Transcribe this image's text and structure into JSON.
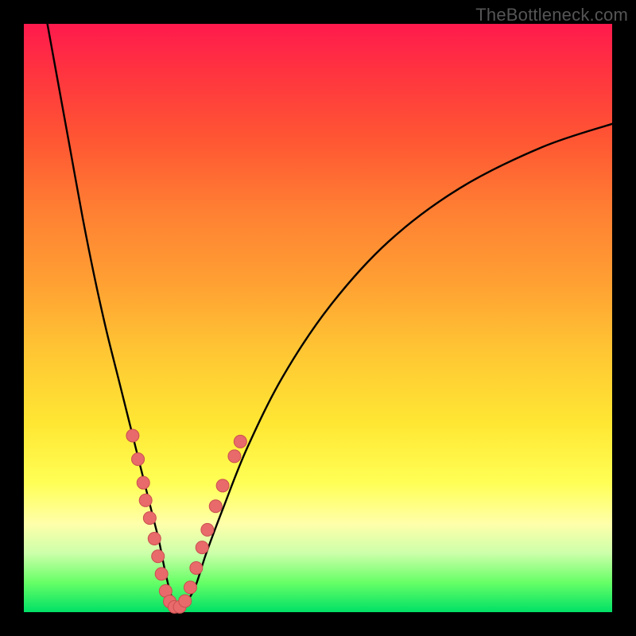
{
  "watermark": "TheBottleneck.com",
  "colors": {
    "frame": "#000000",
    "curve": "#000000",
    "dot_fill": "#e96a6a",
    "dot_stroke": "#c94f4f"
  },
  "chart_data": {
    "type": "line",
    "title": "",
    "xlabel": "",
    "ylabel": "",
    "xlim": [
      0,
      100
    ],
    "ylim": [
      0,
      100
    ],
    "series": [
      {
        "name": "bottleneck-curve",
        "x": [
          4,
          6,
          8,
          10,
          12,
          14,
          16,
          18,
          20,
          21,
          22,
          23,
          24,
          25,
          26,
          27,
          29,
          31,
          34,
          38,
          44,
          52,
          62,
          74,
          88,
          100
        ],
        "y": [
          100,
          89,
          78,
          67,
          57,
          48,
          40,
          32,
          24,
          20,
          16,
          12,
          7,
          3,
          1,
          1,
          4,
          10,
          18,
          28,
          40,
          52,
          63,
          72,
          79,
          83
        ]
      }
    ],
    "dots": {
      "name": "highlight-dots",
      "points": [
        {
          "x": 18.5,
          "y": 30
        },
        {
          "x": 19.4,
          "y": 26
        },
        {
          "x": 20.3,
          "y": 22
        },
        {
          "x": 20.7,
          "y": 19
        },
        {
          "x": 21.4,
          "y": 16
        },
        {
          "x": 22.2,
          "y": 12.5
        },
        {
          "x": 22.8,
          "y": 9.5
        },
        {
          "x": 23.4,
          "y": 6.5
        },
        {
          "x": 24.1,
          "y": 3.6
        },
        {
          "x": 24.8,
          "y": 1.8
        },
        {
          "x": 25.6,
          "y": 0.9
        },
        {
          "x": 26.5,
          "y": 0.9
        },
        {
          "x": 27.4,
          "y": 1.9
        },
        {
          "x": 28.3,
          "y": 4.2
        },
        {
          "x": 29.3,
          "y": 7.5
        },
        {
          "x": 30.3,
          "y": 11.0
        },
        {
          "x": 31.2,
          "y": 14.0
        },
        {
          "x": 32.6,
          "y": 18.0
        },
        {
          "x": 33.8,
          "y": 21.5
        },
        {
          "x": 35.8,
          "y": 26.5
        },
        {
          "x": 36.8,
          "y": 29.0
        }
      ]
    }
  }
}
